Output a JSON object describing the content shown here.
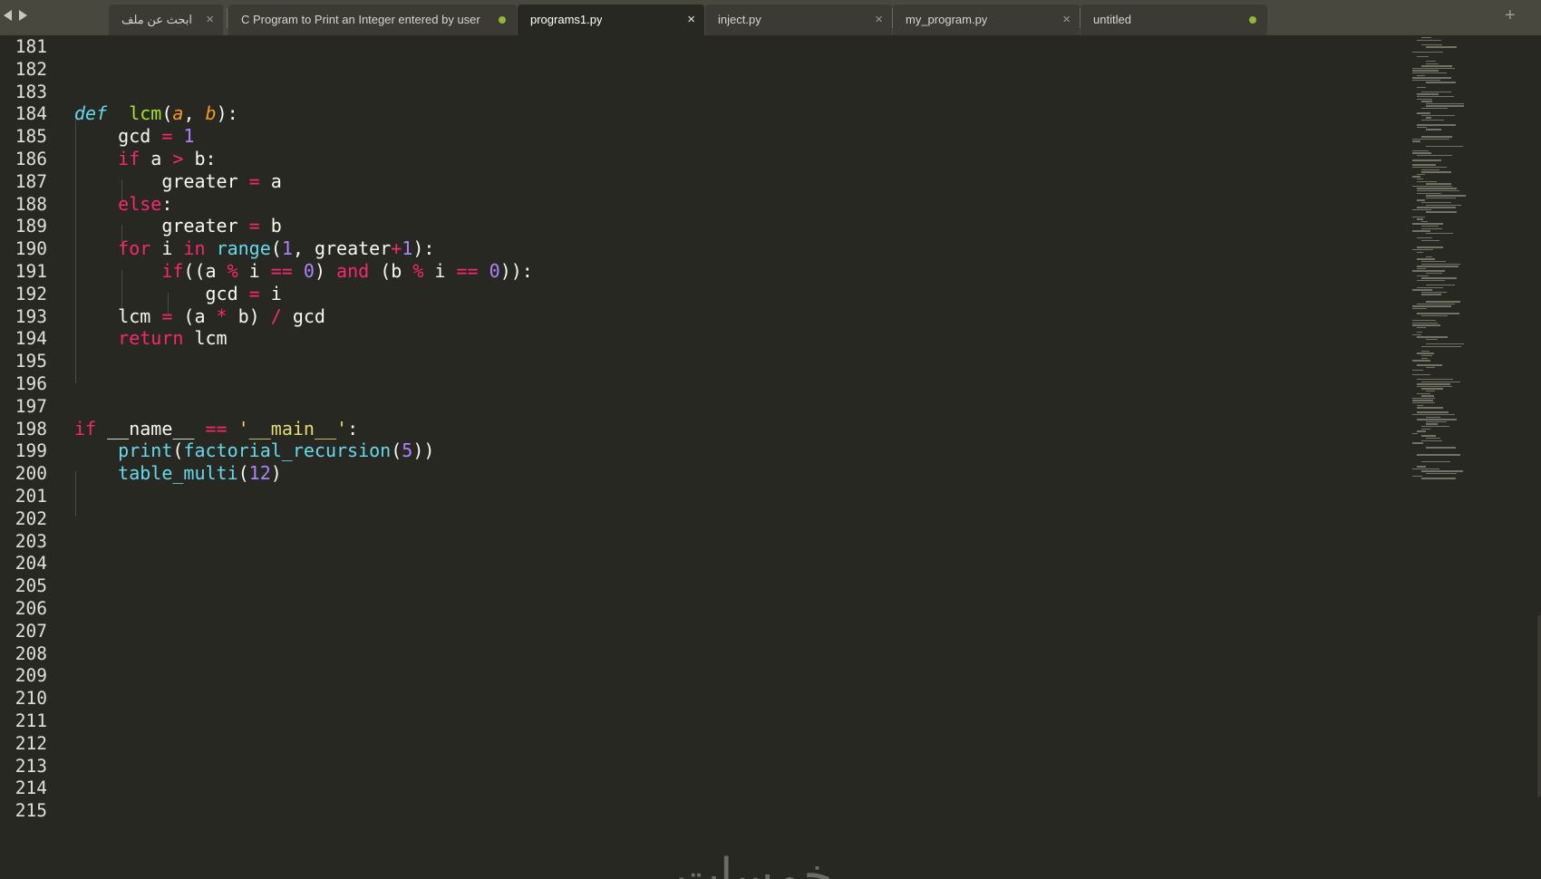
{
  "tabs": [
    {
      "label": "ابحث عن ملف",
      "close": "×",
      "state": "close"
    },
    {
      "label": "C Program to Print an Integer entered by user",
      "close": "",
      "state": "modified"
    },
    {
      "label": "programs1.py",
      "close": "×",
      "state": "active"
    },
    {
      "label": "inject.py",
      "close": "×",
      "state": "close"
    },
    {
      "label": "my_program.py",
      "close": "×",
      "state": "close"
    },
    {
      "label": "untitled",
      "close": "",
      "state": "modified"
    }
  ],
  "new_tab_label": "+",
  "line_numbers": [
    "181",
    "182",
    "183",
    "184",
    "185",
    "186",
    "187",
    "188",
    "189",
    "190",
    "191",
    "192",
    "193",
    "194",
    "195",
    "196",
    "197",
    "198",
    "199",
    "200",
    "201",
    "202",
    "203",
    "204",
    "205",
    "206",
    "207",
    "208",
    "209",
    "210",
    "211",
    "212",
    "213",
    "214",
    "215"
  ],
  "code_lines": [
    [],
    [],
    [],
    [
      [
        "df",
        "def"
      ],
      [
        "",
        "  "
      ],
      [
        "fn",
        "lcm"
      ],
      [
        "",
        "("
      ],
      [
        "pa",
        "a"
      ],
      [
        "",
        ", "
      ],
      [
        "pa",
        "b"
      ],
      [
        "",
        "):"
      ]
    ],
    [
      [
        "",
        "    gcd "
      ],
      [
        "op",
        "="
      ],
      [
        "",
        " "
      ],
      [
        "nm",
        "1"
      ]
    ],
    [
      [
        "",
        "    "
      ],
      [
        "kw",
        "if"
      ],
      [
        "",
        " a "
      ],
      [
        "op",
        ">"
      ],
      [
        "",
        " b:"
      ]
    ],
    [
      [
        "",
        "        greater "
      ],
      [
        "op",
        "="
      ],
      [
        "",
        " a"
      ]
    ],
    [
      [
        "",
        "    "
      ],
      [
        "kw",
        "else"
      ],
      [
        "",
        ":"
      ]
    ],
    [
      [
        "",
        "        greater "
      ],
      [
        "op",
        "="
      ],
      [
        "",
        " b"
      ]
    ],
    [
      [
        "",
        "    "
      ],
      [
        "kw",
        "for"
      ],
      [
        "",
        " i "
      ],
      [
        "kw",
        "in"
      ],
      [
        "",
        " "
      ],
      [
        "bi",
        "range"
      ],
      [
        "",
        "("
      ],
      [
        "nm",
        "1"
      ],
      [
        "",
        ", greater"
      ],
      [
        "op",
        "+"
      ],
      [
        "nm",
        "1"
      ],
      [
        "",
        "):"
      ]
    ],
    [
      [
        "",
        "        "
      ],
      [
        "kw",
        "if"
      ],
      [
        "",
        "((a "
      ],
      [
        "op",
        "%"
      ],
      [
        "",
        " i "
      ],
      [
        "op",
        "=="
      ],
      [
        "",
        " "
      ],
      [
        "nm",
        "0"
      ],
      [
        "",
        ") "
      ],
      [
        "kw",
        "and"
      ],
      [
        "",
        " (b "
      ],
      [
        "op",
        "%"
      ],
      [
        "",
        " i "
      ],
      [
        "op",
        "=="
      ],
      [
        "",
        " "
      ],
      [
        "nm",
        "0"
      ],
      [
        "",
        "))"
      ],
      [
        "",
        ":"
      ]
    ],
    [
      [
        "",
        "            gcd "
      ],
      [
        "op",
        "="
      ],
      [
        "",
        " i"
      ]
    ],
    [
      [
        "",
        "    lcm "
      ],
      [
        "op",
        "="
      ],
      [
        "",
        " (a "
      ],
      [
        "op",
        "*"
      ],
      [
        "",
        " b) "
      ],
      [
        "op",
        "/"
      ],
      [
        "",
        " gcd"
      ]
    ],
    [
      [
        "",
        "    "
      ],
      [
        "kw",
        "return"
      ],
      [
        "",
        " lcm"
      ]
    ],
    [],
    [],
    [],
    [
      [
        "kw",
        "if"
      ],
      [
        "",
        " __name__ "
      ],
      [
        "op",
        "=="
      ],
      [
        "",
        " "
      ],
      [
        "st",
        "'__main__'"
      ],
      [
        "",
        ":"
      ]
    ],
    [
      [
        "",
        "    "
      ],
      [
        "bi",
        "print"
      ],
      [
        "",
        "("
      ],
      [
        "bi",
        "factorial_recursion"
      ],
      [
        "",
        "("
      ],
      [
        "nm",
        "5"
      ],
      [
        "",
        "))"
      ]
    ],
    [
      [
        "",
        "    "
      ],
      [
        "bi",
        "table_multi"
      ],
      [
        "",
        "("
      ],
      [
        "nm",
        "12"
      ],
      [
        "",
        ")"
      ]
    ],
    [],
    [],
    [],
    [],
    [],
    [],
    [],
    [],
    [],
    [],
    [],
    [],
    [],
    [],
    []
  ],
  "watermark": "خمسات",
  "colors": {
    "background": "#272822",
    "tabbar": "#49483e",
    "keyword": "#f92672",
    "function": "#a6e22e",
    "builtin": "#66d9ef",
    "param": "#fd971f",
    "number": "#ae81ff",
    "string": "#e6db74",
    "modified_dot": "#90b83a"
  }
}
